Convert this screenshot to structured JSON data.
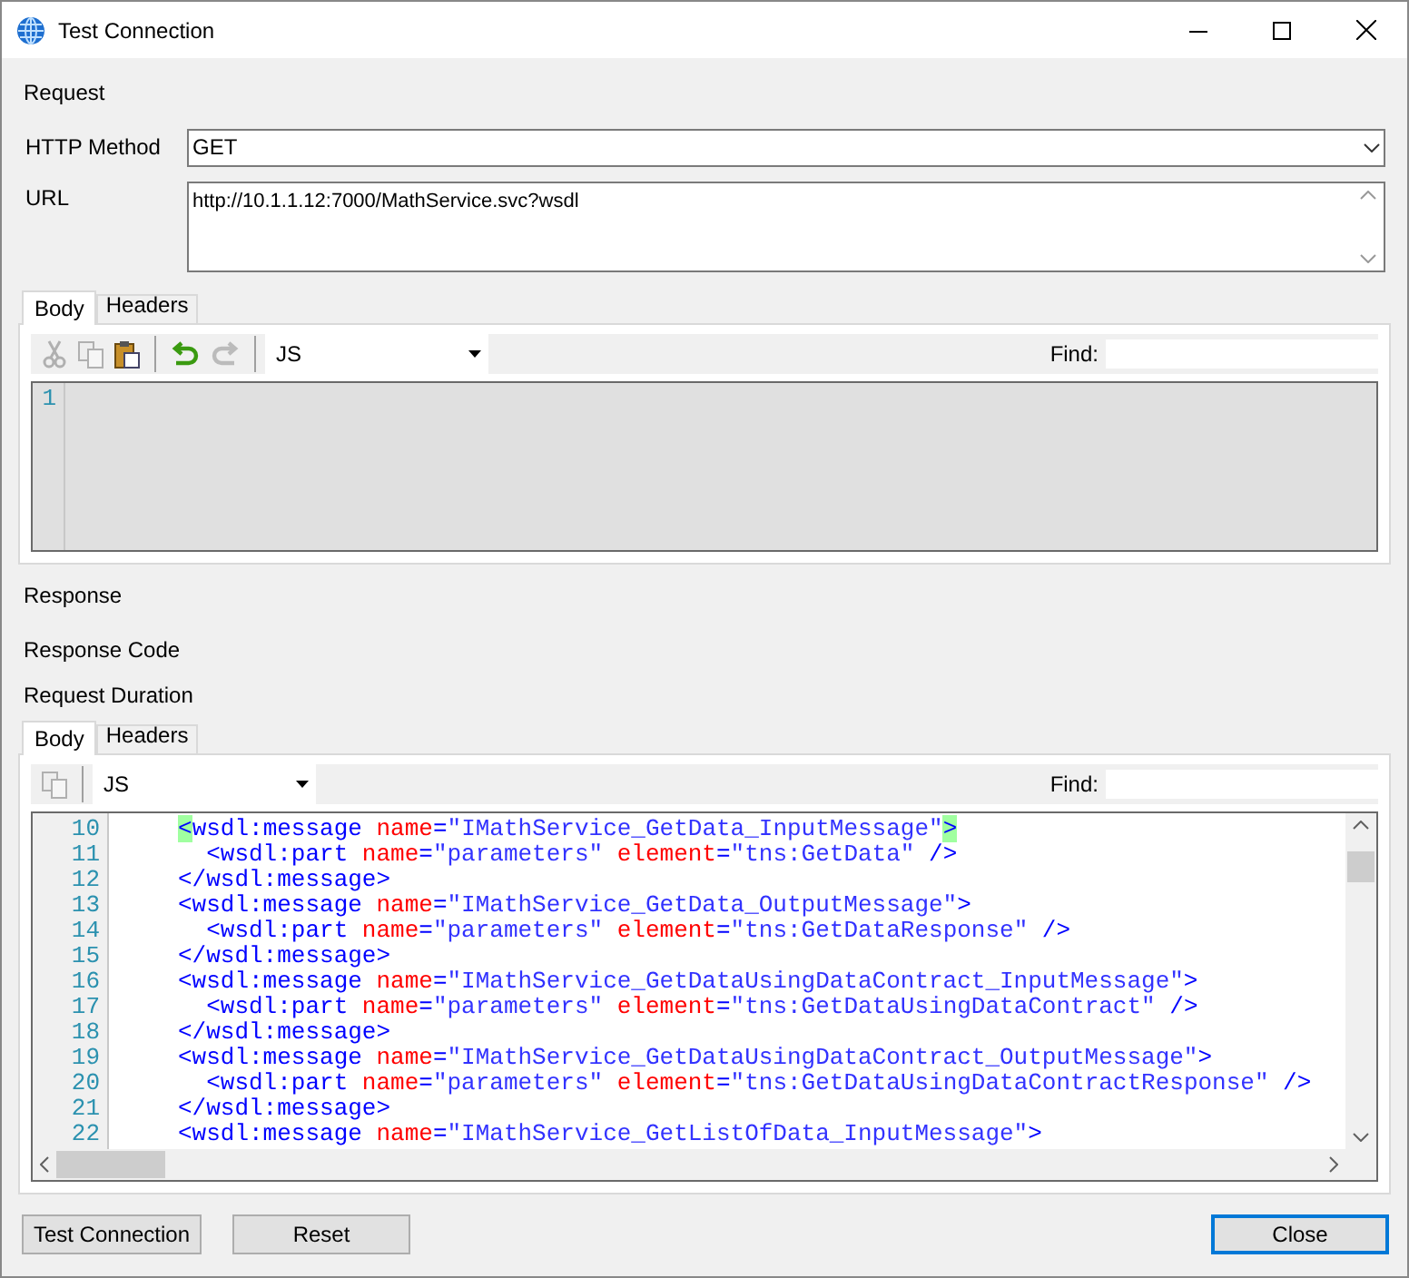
{
  "window": {
    "title": "Test Connection"
  },
  "request": {
    "label": "Request",
    "method_label": "HTTP Method",
    "method": "GET",
    "url_label": "URL",
    "url": "http://10.1.1.12:7000/MathService.svc?wsdl",
    "tabs": [
      {
        "label": "Body",
        "selected": true
      },
      {
        "label": "Headers",
        "selected": false
      }
    ],
    "toolbar": [
      {
        "kind": "cut",
        "disabled": true
      },
      {
        "kind": "copy",
        "disabled": true
      },
      {
        "kind": "paste",
        "disabled": false
      },
      {
        "kind": "separator"
      },
      {
        "kind": "undo",
        "disabled": false
      },
      {
        "kind": "redo",
        "disabled": true
      },
      {
        "kind": "separator"
      }
    ],
    "language": "JS",
    "find_label": "Find:",
    "editor": {
      "disabled": true,
      "lines": [
        {
          "number": "1"
        }
      ]
    }
  },
  "response": {
    "label": "Response",
    "code_label": "Response Code",
    "duration_label": "Request Duration",
    "tabs": [
      {
        "label": "Body",
        "selected": true
      },
      {
        "label": "Headers",
        "selected": false
      }
    ],
    "toolbar": [
      {
        "kind": "copy",
        "disabled": true
      },
      {
        "kind": "separator"
      }
    ],
    "language": "JS",
    "find_label": "Find:",
    "editor": {
      "disabled": false,
      "lines": [
        {
          "number": "10",
          "tokens": [
            {
              "kind": "match",
              "text": "<"
            },
            {
              "kind": "tag",
              "text": "wsdl:message "
            },
            {
              "kind": "attr",
              "text": "name"
            },
            {
              "kind": "tag",
              "text": "="
            },
            {
              "kind": "value",
              "text": "\"IMathService_GetData_InputMessage\""
            },
            {
              "kind": "match",
              "text": ">"
            }
          ]
        },
        {
          "number": "11",
          "tokens": [
            {
              "kind": "tag",
              "text": "  <wsdl:part "
            },
            {
              "kind": "attr",
              "text": "name"
            },
            {
              "kind": "tag",
              "text": "="
            },
            {
              "kind": "value",
              "text": "\"parameters\" "
            },
            {
              "kind": "attr",
              "text": "element"
            },
            {
              "kind": "tag",
              "text": "="
            },
            {
              "kind": "value",
              "text": "\"tns:GetData\""
            },
            {
              "kind": "tag",
              "text": " />"
            }
          ]
        },
        {
          "number": "12",
          "tokens": [
            {
              "kind": "tag",
              "text": "</wsdl:message>"
            }
          ]
        },
        {
          "number": "13",
          "tokens": [
            {
              "kind": "tag",
              "text": "<wsdl:message "
            },
            {
              "kind": "attr",
              "text": "name"
            },
            {
              "kind": "tag",
              "text": "="
            },
            {
              "kind": "value",
              "text": "\"IMathService_GetData_OutputMessage\""
            },
            {
              "kind": "tag",
              "text": ">"
            }
          ]
        },
        {
          "number": "14",
          "tokens": [
            {
              "kind": "tag",
              "text": "  <wsdl:part "
            },
            {
              "kind": "attr",
              "text": "name"
            },
            {
              "kind": "tag",
              "text": "="
            },
            {
              "kind": "value",
              "text": "\"parameters\" "
            },
            {
              "kind": "attr",
              "text": "element"
            },
            {
              "kind": "tag",
              "text": "="
            },
            {
              "kind": "value",
              "text": "\"tns:GetDataResponse\""
            },
            {
              "kind": "tag",
              "text": " />"
            }
          ]
        },
        {
          "number": "15",
          "tokens": [
            {
              "kind": "tag",
              "text": "</wsdl:message>"
            }
          ]
        },
        {
          "number": "16",
          "tokens": [
            {
              "kind": "tag",
              "text": "<wsdl:message "
            },
            {
              "kind": "attr",
              "text": "name"
            },
            {
              "kind": "tag",
              "text": "="
            },
            {
              "kind": "value",
              "text": "\"IMathService_GetDataUsingDataContract_InputMessage\""
            },
            {
              "kind": "tag",
              "text": ">"
            }
          ]
        },
        {
          "number": "17",
          "tokens": [
            {
              "kind": "tag",
              "text": "  <wsdl:part "
            },
            {
              "kind": "attr",
              "text": "name"
            },
            {
              "kind": "tag",
              "text": "="
            },
            {
              "kind": "value",
              "text": "\"parameters\" "
            },
            {
              "kind": "attr",
              "text": "element"
            },
            {
              "kind": "tag",
              "text": "="
            },
            {
              "kind": "value",
              "text": "\"tns:GetDataUsingDataContract\""
            },
            {
              "kind": "tag",
              "text": " />"
            }
          ]
        },
        {
          "number": "18",
          "tokens": [
            {
              "kind": "tag",
              "text": "</wsdl:message>"
            }
          ]
        },
        {
          "number": "19",
          "tokens": [
            {
              "kind": "tag",
              "text": "<wsdl:message "
            },
            {
              "kind": "attr",
              "text": "name"
            },
            {
              "kind": "tag",
              "text": "="
            },
            {
              "kind": "value",
              "text": "\"IMathService_GetDataUsingDataContract_OutputMessage\""
            },
            {
              "kind": "tag",
              "text": ">"
            }
          ]
        },
        {
          "number": "20",
          "tokens": [
            {
              "kind": "tag",
              "text": "  <wsdl:part "
            },
            {
              "kind": "attr",
              "text": "name"
            },
            {
              "kind": "tag",
              "text": "="
            },
            {
              "kind": "value",
              "text": "\"parameters\" "
            },
            {
              "kind": "attr",
              "text": "element"
            },
            {
              "kind": "tag",
              "text": "="
            },
            {
              "kind": "value",
              "text": "\"tns:GetDataUsingDataContractResponse\""
            },
            {
              "kind": "tag",
              "text": " />"
            }
          ]
        },
        {
          "number": "21",
          "tokens": [
            {
              "kind": "tag",
              "text": "</wsdl:message>"
            }
          ]
        },
        {
          "number": "22",
          "tokens": [
            {
              "kind": "tag",
              "text": "<wsdl:message "
            },
            {
              "kind": "attr",
              "text": "name"
            },
            {
              "kind": "tag",
              "text": "="
            },
            {
              "kind": "value",
              "text": "\"IMathService_GetListOfData_InputMessage\""
            },
            {
              "kind": "tag",
              "text": ">"
            }
          ]
        }
      ]
    }
  },
  "buttons": [
    {
      "label": "Test Connection",
      "default": false
    },
    {
      "label": "Reset",
      "default": false
    },
    {
      "label": "Close",
      "default": true
    }
  ]
}
